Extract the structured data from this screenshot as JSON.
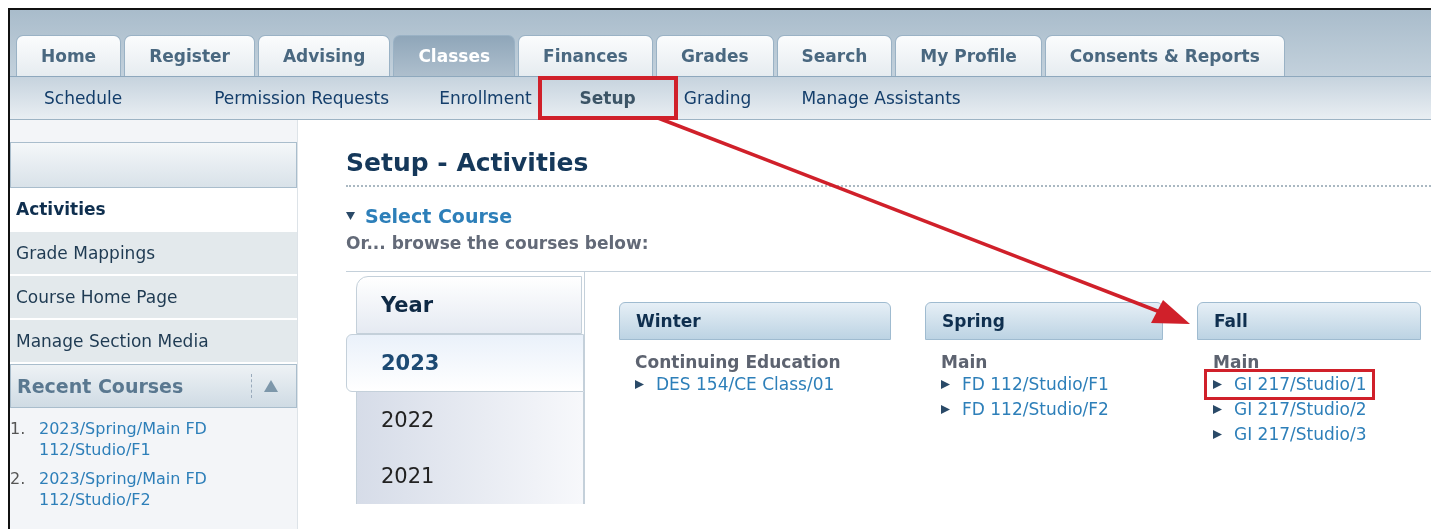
{
  "tabs": [
    {
      "label": "Home",
      "selected": false
    },
    {
      "label": "Register",
      "selected": false
    },
    {
      "label": "Advising",
      "selected": false
    },
    {
      "label": "Classes",
      "selected": true
    },
    {
      "label": "Finances",
      "selected": false
    },
    {
      "label": "Grades",
      "selected": false
    },
    {
      "label": "Search",
      "selected": false
    },
    {
      "label": "My Profile",
      "selected": false
    },
    {
      "label": "Consents & Reports",
      "selected": false
    }
  ],
  "subnav": [
    {
      "label": "Schedule",
      "selected": false,
      "highlighted": false
    },
    {
      "label": "Permission Requests",
      "selected": false,
      "highlighted": false
    },
    {
      "label": "Enrollment",
      "selected": false,
      "highlighted": false
    },
    {
      "label": "Setup",
      "selected": true,
      "highlighted": true
    },
    {
      "label": "Grading",
      "selected": false,
      "highlighted": false
    },
    {
      "label": "Manage Assistants",
      "selected": false,
      "highlighted": false
    }
  ],
  "sidebar": {
    "items": [
      {
        "label": "Activities",
        "selected": true
      },
      {
        "label": "Grade Mappings",
        "selected": false
      },
      {
        "label": "Course Home Page",
        "selected": false
      },
      {
        "label": "Manage Section Media",
        "selected": false
      }
    ],
    "recent": {
      "title": "Recent Courses",
      "expanded": true,
      "items": [
        {
          "number": "1.",
          "label": "2023/Spring/Main FD 112/Studio/F1"
        },
        {
          "number": "2.",
          "label": "2023/Spring/Main FD 112/Studio/F2"
        }
      ]
    }
  },
  "page": {
    "title": "Setup - Activities",
    "select_course": "Select Course",
    "browse_hint": "Or... browse the courses below:"
  },
  "browser": {
    "year_heading": "Year",
    "years": [
      {
        "label": "2023",
        "selected": true
      },
      {
        "label": "2022",
        "selected": false
      },
      {
        "label": "2021",
        "selected": false
      }
    ],
    "terms": [
      {
        "title": "Winter",
        "groups": [
          {
            "name": "Continuing Education",
            "courses": [
              {
                "label": "DES 154/CE Class/01",
                "highlighted": false
              }
            ]
          }
        ]
      },
      {
        "title": "Spring",
        "groups": [
          {
            "name": "Main",
            "courses": [
              {
                "label": "FD 112/Studio/F1",
                "highlighted": false
              },
              {
                "label": "FD 112/Studio/F2",
                "highlighted": false
              }
            ]
          }
        ]
      },
      {
        "title": "Fall",
        "groups": [
          {
            "name": "Main",
            "courses": [
              {
                "label": "GI 217/Studio/1",
                "highlighted": true
              },
              {
                "label": "GI 217/Studio/2",
                "highlighted": false
              },
              {
                "label": "GI 217/Studio/3",
                "highlighted": false
              }
            ]
          }
        ]
      }
    ]
  },
  "annotation": {
    "arrow": true
  }
}
